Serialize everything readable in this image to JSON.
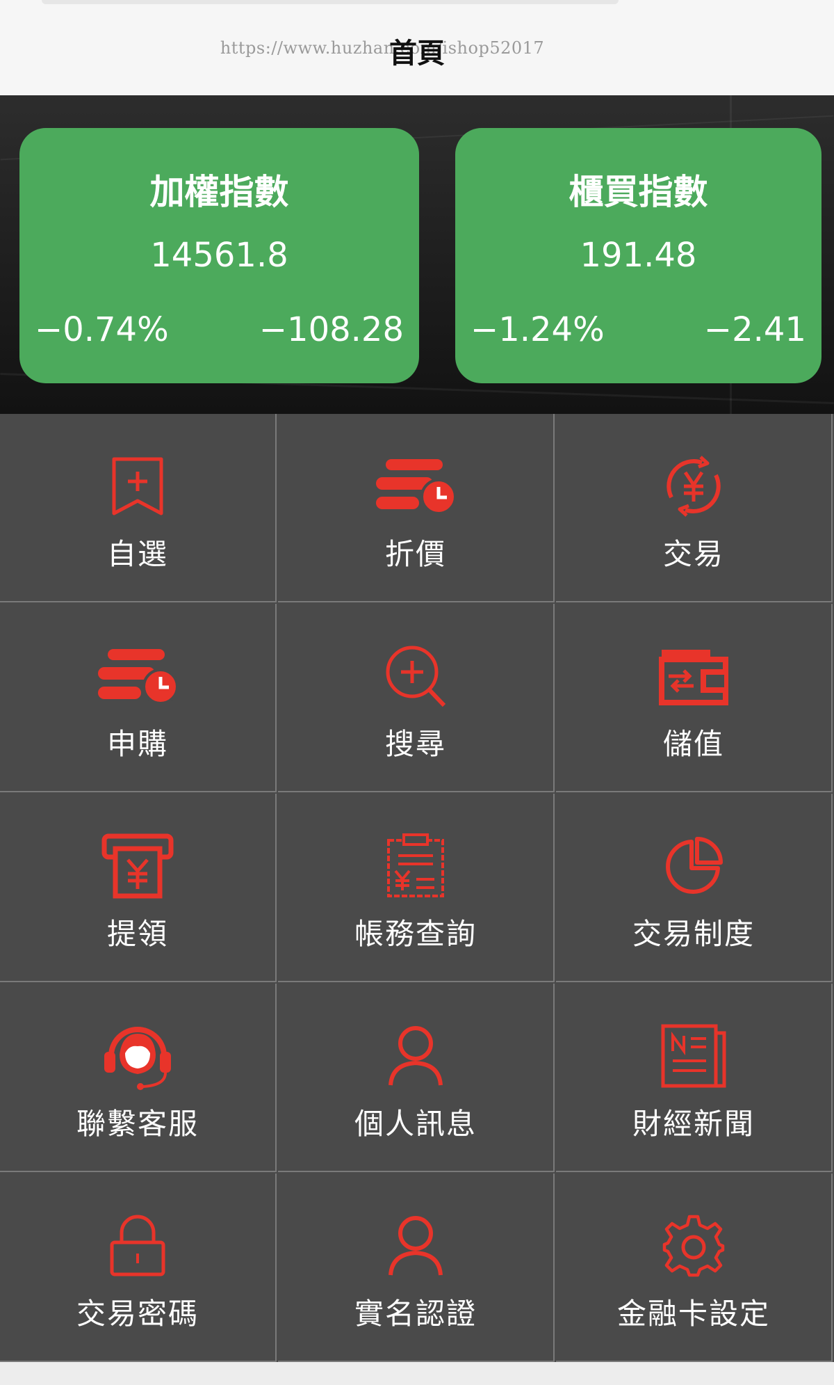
{
  "header": {
    "title": "首頁",
    "watermark": "https://www.huzhan.com/ishop52017"
  },
  "indices": [
    {
      "name": "加權指數",
      "value": "14561.8",
      "change_pct": "−0.74%",
      "change": "−108.28"
    },
    {
      "name": "櫃買指數",
      "value": "191.48",
      "change_pct": "−1.24%",
      "change": "−2.41"
    }
  ],
  "menu": [
    {
      "label": "自選",
      "icon": "bookmark-plus-icon"
    },
    {
      "label": "折價",
      "icon": "stacked-bars-clock-icon"
    },
    {
      "label": "交易",
      "icon": "yen-cycle-icon"
    },
    {
      "label": "申購",
      "icon": "stacked-bars-clock-icon"
    },
    {
      "label": "搜尋",
      "icon": "zoom-in-icon"
    },
    {
      "label": "儲值",
      "icon": "wallet-arrow-icon"
    },
    {
      "label": "提領",
      "icon": "atm-withdraw-icon"
    },
    {
      "label": "帳務查詢",
      "icon": "clipboard-yen-icon"
    },
    {
      "label": "交易制度",
      "icon": "pie-chart-icon"
    },
    {
      "label": "聯繫客服",
      "icon": "headset-agent-icon"
    },
    {
      "label": "個人訊息",
      "icon": "user-icon"
    },
    {
      "label": "財經新聞",
      "icon": "newspaper-icon"
    },
    {
      "label": "交易密碼",
      "icon": "lock-icon"
    },
    {
      "label": "實名認證",
      "icon": "user-icon"
    },
    {
      "label": "金融卡設定",
      "icon": "gear-icon"
    }
  ],
  "colors": {
    "card_green": "#4caa5c",
    "icon_red": "#e8342a",
    "grid_bg": "#4a4a4a"
  }
}
